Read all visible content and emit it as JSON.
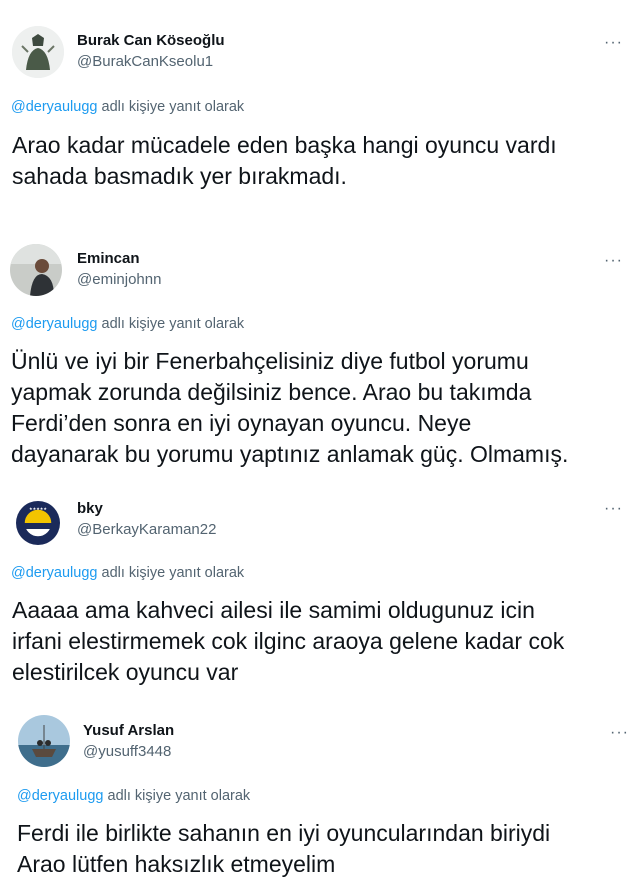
{
  "tweets": [
    {
      "name": "Burak Can Köseoğlu",
      "handle": "@BurakCanKseolu1",
      "mention": "@deryaulugg",
      "reply_suffix": "adlı kişiye yanıt olarak",
      "text": "Arao kadar mücadele eden başka hangi oyuncu vardı\nsahada basmadık yer bırakmadı.",
      "more": "···"
    },
    {
      "name": "Emincan",
      "handle": "@eminjohnn",
      "mention": "@deryaulugg",
      "reply_suffix": "adlı kişiye yanıt olarak",
      "text": "Ünlü ve iyi bir Fenerbahçelisiniz diye futbol yorumu\nyapmak zorunda değilsiniz bence. Arao bu takımda\nFerdi’den sonra en iyi oynayan oyuncu. Neye\ndayanarak bu yorumu yaptınız anlamak güç. Olmamış.",
      "more": "···"
    },
    {
      "name": "bky",
      "handle": "@BerkayKaraman22",
      "mention": "@deryaulugg",
      "reply_suffix": "adlı kişiye yanıt olarak",
      "text": "Aaaaa ama kahveci ailesi ile samimi oldugunuz icin\nirfani elestirmemek cok ilginc araoya gelene kadar cok\nelestirilcek oyuncu var",
      "more": "···"
    },
    {
      "name": "Yusuf Arslan",
      "handle": "@yusuff3448",
      "mention": "@deryaulugg",
      "reply_suffix": "adlı kişiye yanıt olarak",
      "text": "Ferdi ile birlikte sahanın en iyi oyuncularından biriydi\nArao lütfen haksızlık etmeyelim",
      "more": "···"
    }
  ]
}
